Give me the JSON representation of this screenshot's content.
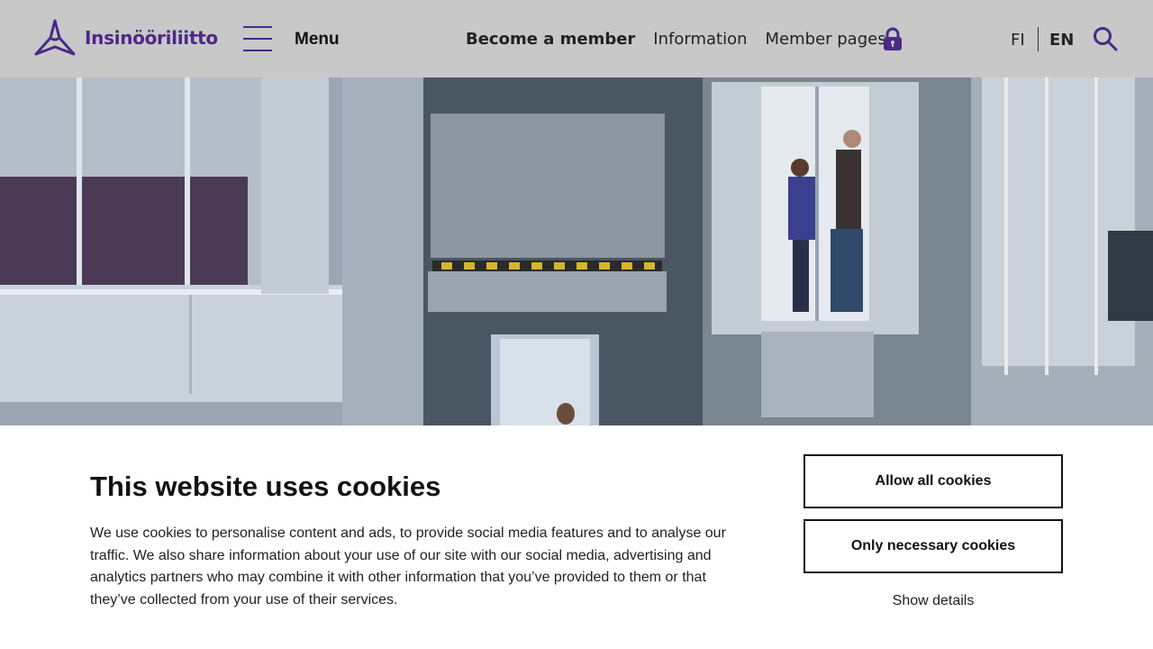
{
  "header": {
    "logo_text": "Insinööriliitto",
    "menu_label": "Menu",
    "nav": {
      "become_member": "Become a member",
      "information": "Information",
      "member_pages": "Member pages"
    },
    "lang_fi": "FI",
    "lang_en": "EN",
    "icons": [
      "logo-icon",
      "hamburger-icon",
      "lock-icon",
      "search-icon"
    ]
  },
  "colors": {
    "brand": "#4a2a86",
    "header_bg": "#c8c8c8"
  },
  "cookie": {
    "title": "This website uses cookies",
    "text": "We use cookies to personalise content and ads, to provide social media features and to analyse our traffic. We also share information about your use of our site with our social media, advertising and analytics partners who may combine it with other information that you’ve provided to them or that they’ve collected from your use of their services.",
    "allow_all": "Allow all cookies",
    "only_necessary": "Only necessary cookies",
    "show_details": "Show details"
  }
}
